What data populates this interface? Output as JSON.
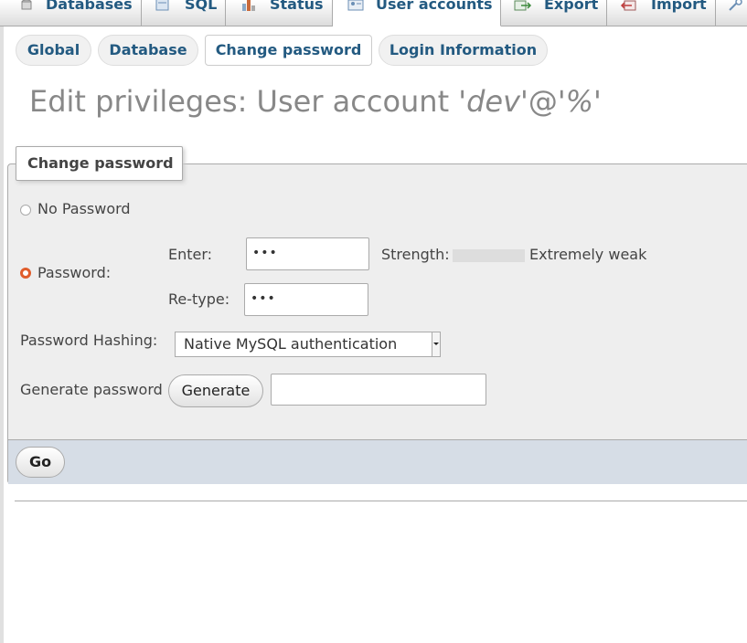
{
  "top_tabs": [
    {
      "label": "Databases",
      "icon": "database-icon"
    },
    {
      "label": "SQL",
      "icon": "sql-icon"
    },
    {
      "label": "Status",
      "icon": "status-icon"
    },
    {
      "label": "User accounts",
      "icon": "user-accounts-icon"
    },
    {
      "label": "Export",
      "icon": "export-icon"
    },
    {
      "label": "Import",
      "icon": "import-icon"
    }
  ],
  "sub_tabs": [
    {
      "label": "Global"
    },
    {
      "label": "Database"
    },
    {
      "label": "Change password"
    },
    {
      "label": "Login Information"
    }
  ],
  "title": {
    "prefix": "Edit privileges: User account '",
    "user": "dev",
    "middle": "'@'",
    "host": "%",
    "suffix": "'"
  },
  "change_password": {
    "legend": "Change password",
    "no_password_label": "No Password",
    "password_label": "Password:",
    "enter_label": "Enter:",
    "enter_value": "•••",
    "retype_label": "Re-type:",
    "retype_value": "•••",
    "strength_label": "Strength:",
    "strength_text": "Extremely weak",
    "hashing_label": "Password Hashing:",
    "hashing_value": "Native MySQL authentication",
    "generate_label": "Generate password",
    "generate_button": "Generate",
    "generated_value": ""
  },
  "footer": {
    "go_button": "Go"
  },
  "colors": {
    "link": "#235a81",
    "radio_selected": "#e05d2c",
    "footer_bar": "#d6dde6",
    "fieldset_bg": "#eeeeee"
  }
}
